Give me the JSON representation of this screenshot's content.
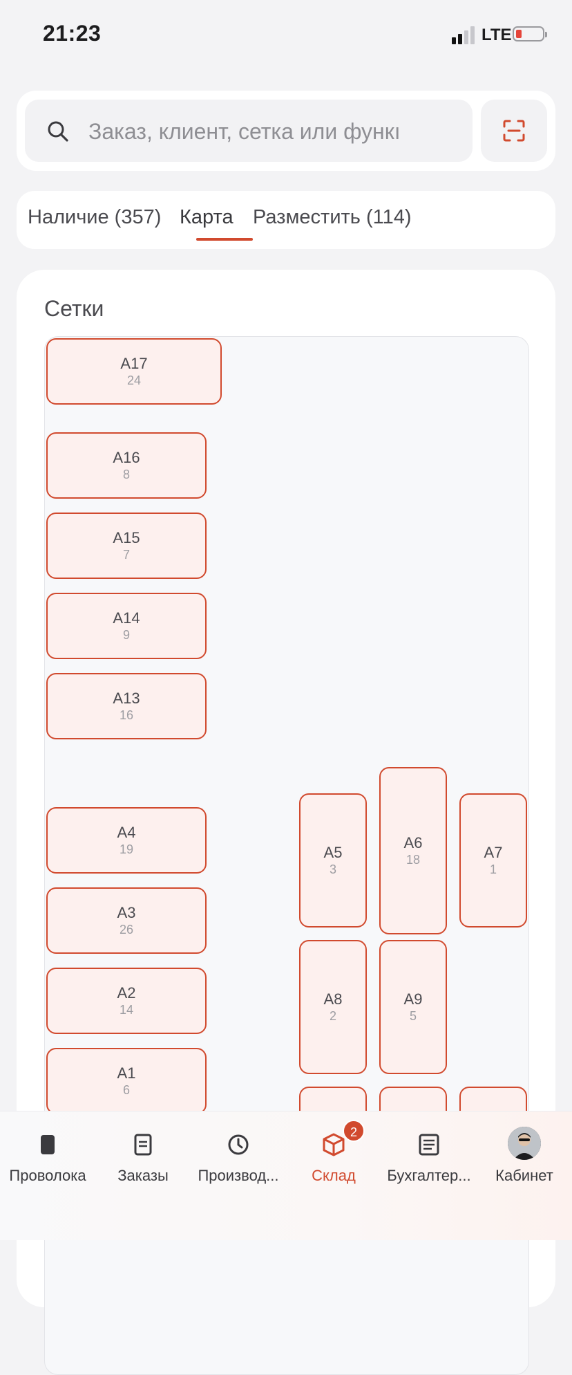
{
  "status_bar": {
    "time": "21:23",
    "network": "LTE"
  },
  "search": {
    "placeholder": "Заказ, клиент, сетка или функı",
    "value": ""
  },
  "tabs": [
    {
      "label": "Наличие (357)",
      "active": false
    },
    {
      "label": "Карта",
      "active": true
    },
    {
      "label": "Разместить (114)",
      "active": false
    }
  ],
  "grids": {
    "title": "Сетки",
    "cells": [
      {
        "name": "A17",
        "count": "24"
      },
      {
        "name": "A16",
        "count": "8"
      },
      {
        "name": "A15",
        "count": "7"
      },
      {
        "name": "A14",
        "count": "9"
      },
      {
        "name": "A13",
        "count": "16"
      },
      {
        "name": "A4",
        "count": "19"
      },
      {
        "name": "A3",
        "count": "26"
      },
      {
        "name": "A2",
        "count": "14"
      },
      {
        "name": "A1",
        "count": "6"
      },
      {
        "name": "A5",
        "count": "3"
      },
      {
        "name": "A6",
        "count": "18"
      },
      {
        "name": "A7",
        "count": "1"
      },
      {
        "name": "A8",
        "count": "2"
      },
      {
        "name": "A9",
        "count": "5"
      }
    ]
  },
  "bottom_nav": [
    {
      "label": "Проволока",
      "icon": "wire-spool-icon"
    },
    {
      "label": "Заказы",
      "icon": "document-icon"
    },
    {
      "label": "Производ...",
      "icon": "clock-icon"
    },
    {
      "label": "Склад",
      "icon": "box-icon",
      "badge": "2",
      "active": true
    },
    {
      "label": "Бухгалтер...",
      "icon": "ledger-icon"
    },
    {
      "label": "Кабинет",
      "icon": "avatar"
    }
  ],
  "colors": {
    "accent": "#d14a2e",
    "cell_fill": "#fdf0ee",
    "background": "#f3f3f5"
  }
}
